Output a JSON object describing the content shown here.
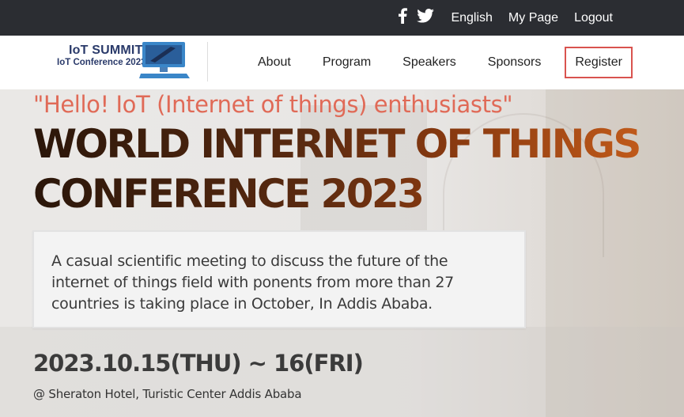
{
  "topbar": {
    "social": [
      "facebook-icon",
      "twitter-icon"
    ],
    "language": "English",
    "mypage": "My Page",
    "logout": "Logout"
  },
  "logo": {
    "title": "IoT SUMMIT",
    "subtitle": "IoT Conference 2023"
  },
  "nav": {
    "items": [
      {
        "label": "About"
      },
      {
        "label": "Program"
      },
      {
        "label": "Speakers"
      },
      {
        "label": "Sponsors"
      }
    ],
    "register": "Register"
  },
  "hero": {
    "tagline": "\"Hello! IoT (Internet of things) enthusiasts\"",
    "headline_line1": "WORLD INTERNET OF THINGS",
    "headline_line2": "CONFERENCE 2023",
    "description": "A casual scientific meeting to discuss the future of the internet of things field with ponents from more than 27 countries is taking place in October, In Addis Ababa.",
    "date": "2023.10.15(THU) ~ 16(FRI)",
    "venue": "@ Sheraton Hotel, Turistic Center Addis Ababa"
  },
  "colors": {
    "topbar_bg": "#2b2d32",
    "accent_red": "#d9534f",
    "tagline": "#e06a57"
  }
}
